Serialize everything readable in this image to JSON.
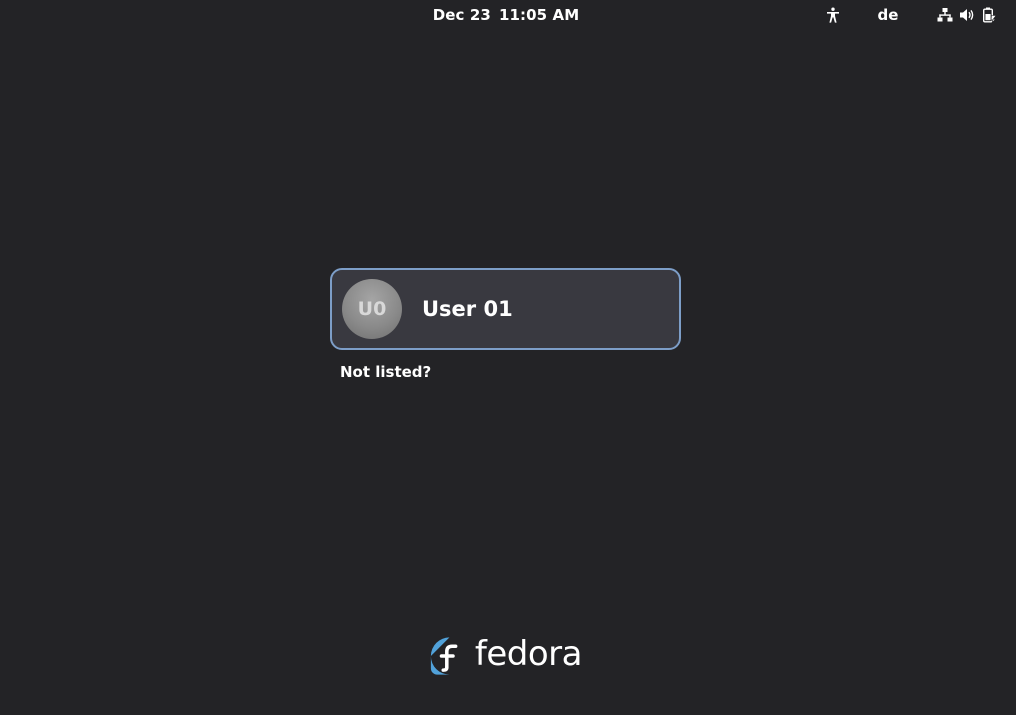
{
  "topbar": {
    "date": "Dec 23",
    "time": "11:05 AM",
    "keyboard_layout": "de",
    "icons": [
      "accessibility-icon",
      "network-wired-icon",
      "volume-icon",
      "battery-icon"
    ]
  },
  "login": {
    "users": [
      {
        "initials": "U0",
        "name": "User 01"
      }
    ],
    "not_listed_label": "Not listed?"
  },
  "branding": {
    "logo_text": "fedora",
    "logo_color": "#51a2da"
  },
  "colors": {
    "background": "#232326",
    "card_background": "#393940",
    "card_border_focus": "#7d9ec8",
    "text": "#ffffff"
  }
}
